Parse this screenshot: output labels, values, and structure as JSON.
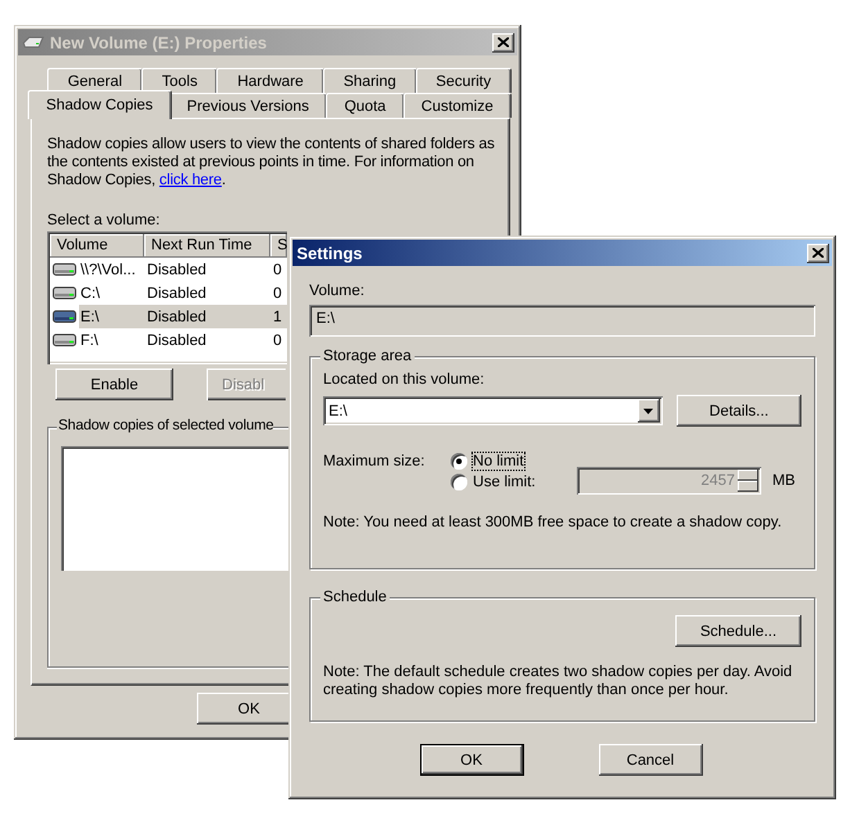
{
  "properties": {
    "title": "New Volume (E:) Properties",
    "tab_rows": [
      {
        "tabs": [
          {
            "label": "General",
            "selected": false
          },
          {
            "label": "Tools",
            "selected": false
          },
          {
            "label": "Hardware",
            "selected": false
          },
          {
            "label": "Sharing",
            "selected": false
          },
          {
            "label": "Security",
            "selected": false
          }
        ]
      },
      {
        "tabs": [
          {
            "label": "Shadow Copies",
            "selected": true
          },
          {
            "label": "Previous Versions",
            "selected": false
          },
          {
            "label": "Quota",
            "selected": false
          },
          {
            "label": "Customize",
            "selected": false
          }
        ]
      }
    ],
    "description": {
      "text": "Shadow copies allow users to view the contents of shared folders as the contents existed at previous points in time. For information on Shadow Copies, ",
      "link": "click here",
      "after": "."
    },
    "select_label": "Select a volume:",
    "volume_list": {
      "columns": [
        "Volume",
        "Next Run Time",
        "S"
      ],
      "rows": [
        {
          "cells": [
            "\\\\?\\Vol...",
            "Disabled",
            "0"
          ],
          "selected": false
        },
        {
          "cells": [
            "C:\\",
            "Disabled",
            "0"
          ],
          "selected": false
        },
        {
          "cells": [
            "E:\\",
            "Disabled",
            "1"
          ],
          "selected": true
        },
        {
          "cells": [
            "F:\\",
            "Disabled",
            "0"
          ],
          "selected": false
        }
      ]
    },
    "buttons": [
      {
        "label": "Enable",
        "disabled": false
      },
      {
        "label": "Disabl",
        "disabled": true
      }
    ],
    "copies_group": "Shadow copies of selected volume",
    "ok_button": "OK"
  },
  "settings": {
    "title": "Settings",
    "volume_label": "Volume:",
    "volume_value": "E:\\",
    "storage_area": {
      "title": "Storage area",
      "located_label": "Located on this volume:",
      "located_value": "E:\\",
      "details_button": "Details...",
      "max_size_label": "Maximum size:",
      "options": [
        {
          "label": "No limit",
          "selected": true
        },
        {
          "label": "Use limit:",
          "selected": false
        }
      ],
      "limit_value": "2457",
      "limit_disabled": true,
      "unit": "MB",
      "note": "Note: You need at least 300MB free space to create a shadow copy."
    },
    "schedule": {
      "title": "Schedule",
      "button": "Schedule...",
      "note": "Note: The default schedule creates two shadow copies per day. Avoid creating shadow copies more frequently than once per hour."
    },
    "buttons": [
      {
        "label": "OK",
        "default": true
      },
      {
        "label": "Cancel",
        "default": false
      }
    ]
  }
}
